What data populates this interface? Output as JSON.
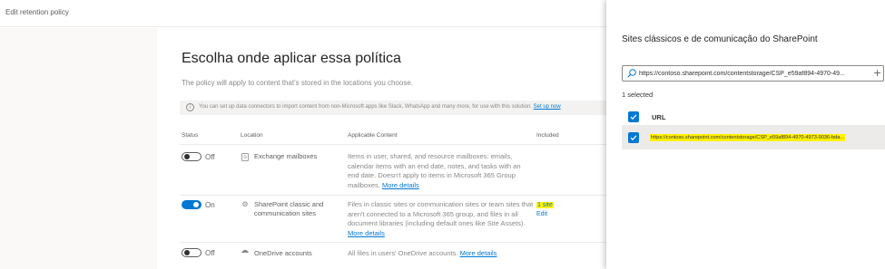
{
  "topbar": {
    "title": "Edit retention policy"
  },
  "main": {
    "title": "Escolha onde aplicar essa política",
    "description": "The policy will apply to content that's stored in the locations you choose.",
    "info_text": "You can set up data connectors to import content from non-Microsoft apps like Slack, WhatsApp and many more, for use with this solution.",
    "info_link": "Set up now",
    "columns": {
      "status": "Status",
      "location": "Location",
      "content": "Applicable Content",
      "included": "Included"
    },
    "rows": [
      {
        "toggle_state": "Off",
        "location": "Exchange mailboxes",
        "content": "Items in user, shared, and resource mailboxes: emails, calendar items with an end date, notes, and tasks with an end date. Doesn't apply to items in Microsoft 365 Group mailboxes.",
        "link": "More details"
      },
      {
        "toggle_state": "On",
        "location": "SharePoint classic and communication sites",
        "content": "Files in classic sites or communication sites or team sites that aren't connected to a Microsoft 365 group, and files in all document libraries (including default ones like Site Assets).",
        "link": "More details",
        "included_count": "1 site",
        "included_edit": "Edit"
      },
      {
        "toggle_state": "Off",
        "location": "OneDrive accounts",
        "content": "All files in users' OneDrive accounts.",
        "link": "More details"
      }
    ]
  },
  "panel": {
    "title": "Sites clássicos e de comunicação do SharePoint",
    "search_value": "https://contoso.sharepoint.com/contentstorage/CSP_e59af894-4970-49...",
    "selected_count": "1 selected",
    "column_url": "URL",
    "rows": [
      {
        "url": "https://contoso.sharepoint.com/contentstorage/CSP_e59af894-4970-4973-9036-bda..."
      }
    ]
  },
  "colors": {
    "accent": "#0078d4",
    "highlight": "#fff100"
  }
}
